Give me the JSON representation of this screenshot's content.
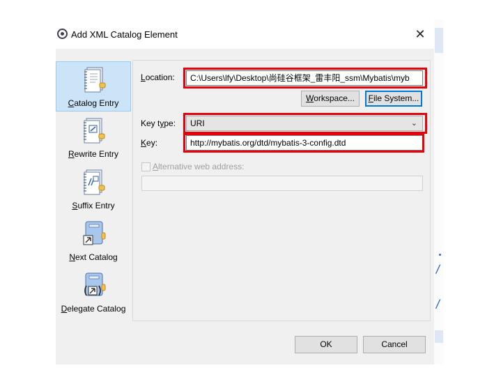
{
  "dialog": {
    "title": "Add XML Catalog Element",
    "close_glyph": "✕"
  },
  "sidebar": {
    "items": [
      {
        "label_first": "C",
        "label_rest": "atalog Entry",
        "icon": "catalog-entry-icon",
        "selected": true
      },
      {
        "label_first": "R",
        "label_rest": "ewrite Entry",
        "icon": "rewrite-entry-icon",
        "selected": false
      },
      {
        "label_first": "S",
        "label_rest": "uffix Entry",
        "icon": "suffix-entry-icon",
        "selected": false
      },
      {
        "label_first": "N",
        "label_rest": "ext Catalog",
        "icon": "next-catalog-icon",
        "selected": false
      },
      {
        "label_first": "D",
        "label_rest": "elegate Catalog",
        "icon": "delegate-catalog-icon",
        "selected": false
      }
    ]
  },
  "form": {
    "location_label_first": "L",
    "location_label_rest": "ocation:",
    "location_value": "C:\\Users\\lfy\\Desktop\\尚硅谷框架_雷丰阳_ssm\\Mybatis\\myb",
    "workspace_button_first": "W",
    "workspace_button_rest": "orkspace...",
    "filesystem_button_first": "F",
    "filesystem_button_rest": "ile System...",
    "keytype_label_first": "Key t",
    "keytype_label_u": "y",
    "keytype_label_rest": "pe:",
    "keytype_value": "URI",
    "key_label_first": "K",
    "key_label_rest": "ey:",
    "key_value": "http://mybatis.org/dtd/mybatis-3-config.dtd",
    "alt_checkbox_checked": false,
    "alt_label_first": "A",
    "alt_label_rest": "lternative web address:",
    "alt_value": ""
  },
  "footer": {
    "ok_label": "OK",
    "cancel_label": "Cancel"
  },
  "colors": {
    "highlight": "#e8000b",
    "selection": "#cce4f7",
    "focus": "#0078d7"
  }
}
